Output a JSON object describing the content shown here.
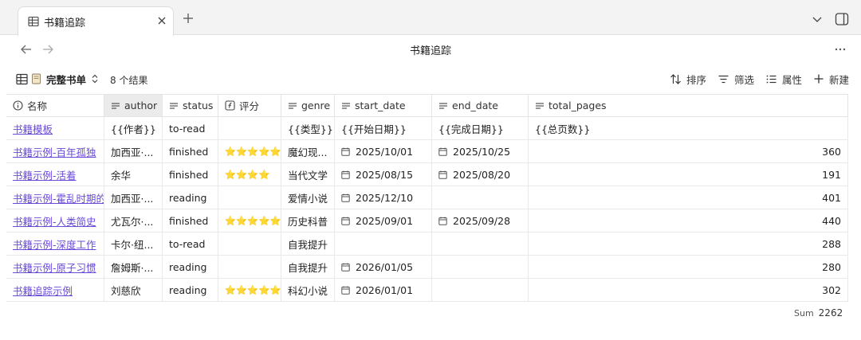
{
  "tab": {
    "title": "书籍追踪"
  },
  "header": {
    "view_title": "书籍追踪"
  },
  "toolbar": {
    "view_name": "完整书单",
    "result_count": "8 个结果",
    "sort_label": "排序",
    "filter_label": "筛选",
    "properties_label": "属性",
    "new_label": "新建"
  },
  "table": {
    "columns": [
      {
        "label": "名称",
        "icon": "info-icon"
      },
      {
        "label": "author",
        "icon": "text-lines-icon"
      },
      {
        "label": "status",
        "icon": "text-lines-icon"
      },
      {
        "label": "评分",
        "icon": "formula-icon"
      },
      {
        "label": "genre",
        "icon": "text-lines-icon"
      },
      {
        "label": "start_date",
        "icon": "text-lines-icon"
      },
      {
        "label": "end_date",
        "icon": "text-lines-icon"
      },
      {
        "label": "total_pages",
        "icon": "text-lines-icon"
      }
    ],
    "rows": [
      {
        "name": "书籍模板",
        "author": "{{作者}}",
        "status": "to-read",
        "rating": "",
        "genre": "{{类型}}",
        "start_date": "{{开始日期}}",
        "end_date": "{{完成日期}}",
        "total_pages": "{{总页数}}",
        "template": true
      },
      {
        "name": "书籍示例-百年孤独",
        "author": "加西亚·...",
        "status": "finished",
        "rating": "⭐⭐⭐⭐⭐",
        "genre": "魔幻现...",
        "start_date": "2025/10/01",
        "end_date": "2025/10/25",
        "total_pages": "360"
      },
      {
        "name": "书籍示例-活着",
        "author": "余华",
        "status": "finished",
        "rating": "⭐⭐⭐⭐",
        "genre": "当代文学",
        "start_date": "2025/08/15",
        "end_date": "2025/08/20",
        "total_pages": "191"
      },
      {
        "name": "书籍示例-霍乱时期的",
        "author": "加西亚·...",
        "status": "reading",
        "rating": "",
        "genre": "爱情小说",
        "start_date": "2025/12/10",
        "end_date": "",
        "total_pages": "401"
      },
      {
        "name": "书籍示例-人类简史",
        "author": "尤瓦尔·...",
        "status": "finished",
        "rating": "⭐⭐⭐⭐⭐",
        "genre": "历史科普",
        "start_date": "2025/09/01",
        "end_date": "2025/09/28",
        "total_pages": "440"
      },
      {
        "name": "书籍示例-深度工作",
        "author": "卡尔·纽...",
        "status": "to-read",
        "rating": "",
        "genre": "自我提升",
        "start_date": "",
        "end_date": "",
        "total_pages": "288"
      },
      {
        "name": "书籍示例-原子习惯",
        "author": "詹姆斯·...",
        "status": "reading",
        "rating": "",
        "genre": "自我提升",
        "start_date": "2026/01/05",
        "end_date": "",
        "total_pages": "280"
      },
      {
        "name": "书籍追踪示例",
        "author": "刘慈欣",
        "status": "reading",
        "rating": "⭐⭐⭐⭐⭐",
        "genre": "科幻小说",
        "start_date": "2026/01/01",
        "end_date": "",
        "total_pages": "302"
      }
    ],
    "sum_label": "Sum",
    "sum_value": "2262"
  },
  "colors": {
    "link": "#6a4bd8",
    "star": "#f4c22b",
    "selected_header": "#ebebeb"
  }
}
